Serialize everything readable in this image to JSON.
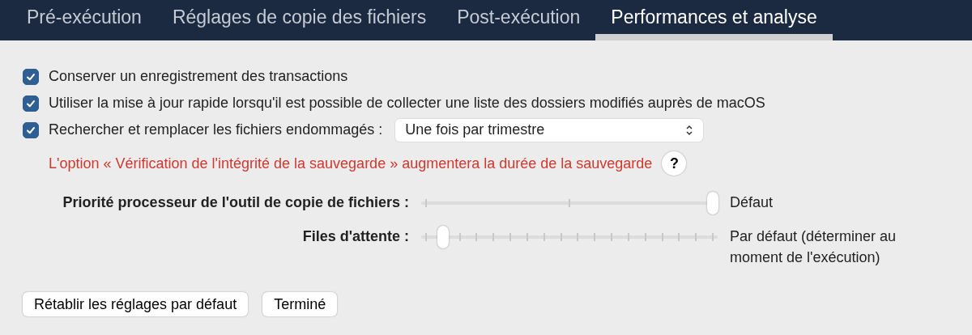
{
  "tabs": [
    {
      "label": "Pré-exécution",
      "selected": false
    },
    {
      "label": "Réglages de copie des fichiers",
      "selected": false
    },
    {
      "label": "Post-exécution",
      "selected": false
    },
    {
      "label": "Performances et analyse",
      "selected": true
    }
  ],
  "options": [
    {
      "label": "Conserver un enregistrement des transactions",
      "checked": true
    },
    {
      "label": "Utiliser la mise à jour rapide lorsqu'il est possible de collecter une liste des dossiers modifiés auprès de macOS",
      "checked": true
    },
    {
      "label": "Rechercher et remplacer les fichiers endommagés :",
      "checked": true,
      "dropdown": "Une fois par trimestre"
    }
  ],
  "warning": "L'option « Vérification de l'intégrité de la sauvegarde » augmentera la durée de la sauvegarde",
  "help_button": "?",
  "sliders": [
    {
      "label": "Priorité processeur de l'outil de copie de fichiers :",
      "kind": "coarse",
      "level": 1,
      "reading": "Défaut"
    },
    {
      "label": "Files d'attente :",
      "kind": "fine",
      "level": 0.06,
      "reading": "Par défaut (déterminer au moment de l'exécution)"
    }
  ],
  "buttons": [
    "Rétablir les réglages par défaut",
    "Terminé"
  ]
}
